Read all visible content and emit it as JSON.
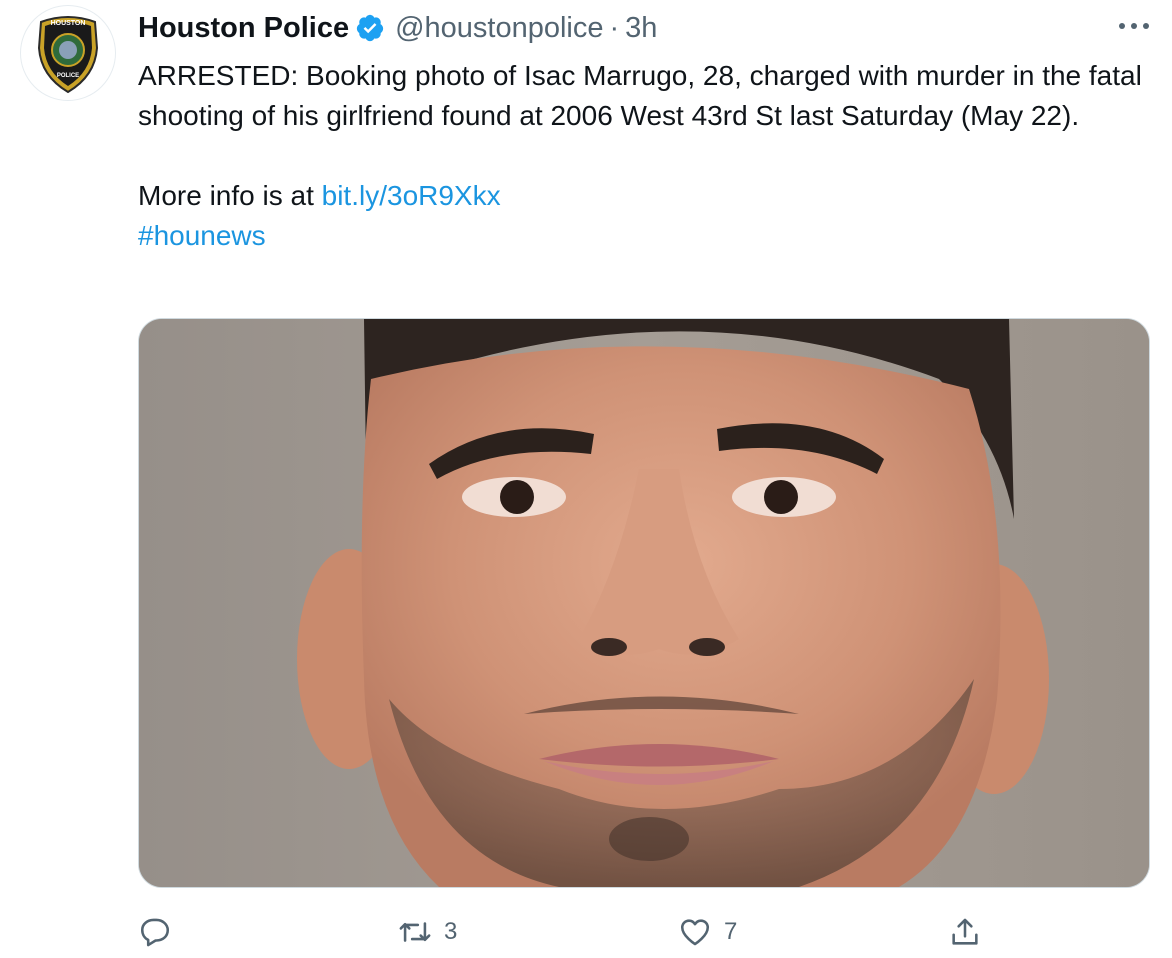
{
  "author": {
    "name": "Houston Police",
    "handle": "@houstonpolice",
    "separator": "·",
    "time": "3h",
    "verified": true,
    "avatar_icon": "houston-police-badge",
    "avatar_text_top": "HOUSTON",
    "avatar_text_bottom": "POLICE"
  },
  "tweet": {
    "paragraph1": "ARRESTED: Booking photo of Isac Marrugo, 28, charged with murder in the fatal shooting of his girlfriend found at 2006 West 43rd St last Saturday (May 22).",
    "more_info_prefix": "More info is at ",
    "link": "bit.ly/3oR9Xkx",
    "hashtag": "#hounews"
  },
  "media": {
    "kind": "booking-photo"
  },
  "actions": {
    "reply": {
      "icon": "reply-icon",
      "count": ""
    },
    "retweet": {
      "icon": "retweet-icon",
      "count": "3"
    },
    "like": {
      "icon": "heart-icon",
      "count": "7"
    },
    "share": {
      "icon": "share-icon",
      "count": ""
    }
  },
  "colors": {
    "link": "#1b95e0",
    "verified": "#1da1f2",
    "secondary_text": "#536471",
    "primary_text": "#0f1419"
  }
}
